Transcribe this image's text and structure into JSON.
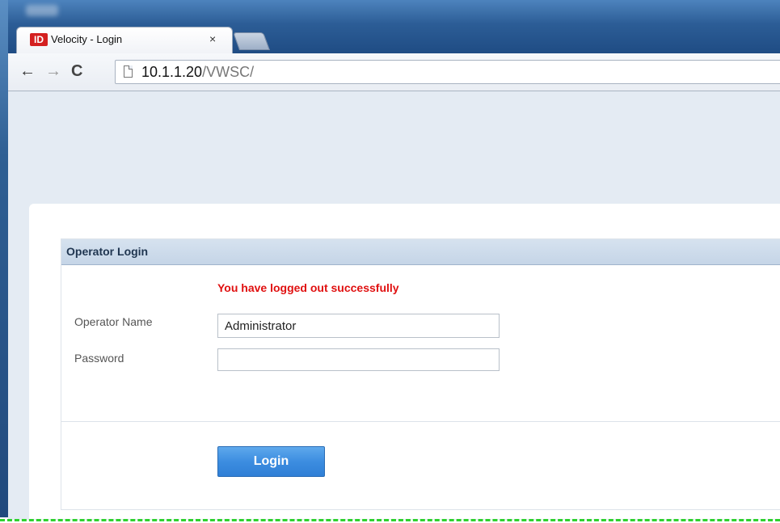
{
  "browser": {
    "tab": {
      "favicon_text": "ID",
      "title": "Velocity - Login",
      "close_glyph": "×"
    },
    "nav": {
      "back_glyph": "←",
      "forward_glyph": "→",
      "reload_glyph": "C"
    },
    "address": {
      "host": "10.1.1.20",
      "path": "/VWSC/"
    }
  },
  "login": {
    "header": "Operator Login",
    "message": "You have logged out successfully",
    "fields": {
      "operator_name_label": "Operator Name",
      "operator_name_value": "Administrator",
      "password_label": "Password",
      "password_value": ""
    },
    "button_label": "Login"
  },
  "colors": {
    "message": "#e01010",
    "button": "#3c8de0",
    "header_bg": "#c5d5e7",
    "page_bg": "#e4ebf3"
  },
  "icons": [
    "back-arrow-icon",
    "forward-arrow-icon",
    "reload-icon",
    "page-icon",
    "close-icon"
  ]
}
